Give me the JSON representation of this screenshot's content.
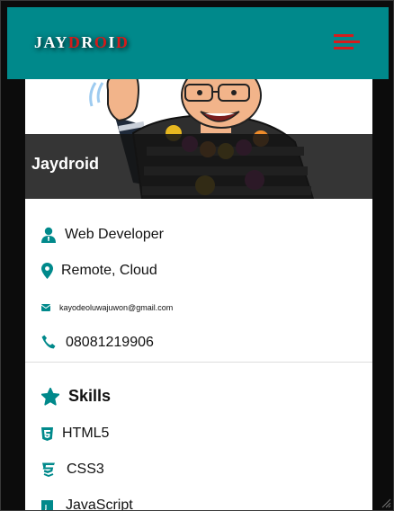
{
  "navbar": {
    "brand_parts": [
      "JAY",
      "D",
      "R",
      "O",
      "I",
      "D"
    ],
    "brand_colors": {
      "white": "#ffffff",
      "red": "#d41b1b"
    },
    "menu_icon": "hamburger-menu-icon",
    "background": "#00898b"
  },
  "profile": {
    "name": "Jaydroid",
    "photo_alt": "avatar-illustration"
  },
  "details": [
    {
      "icon": "user-tie-icon",
      "text": "Web Developer"
    },
    {
      "icon": "location-pin-icon",
      "text": "Remote, Cloud"
    },
    {
      "icon": "envelope-icon",
      "text": "kayodeoluwajuwon@gmail.com"
    },
    {
      "icon": "phone-icon",
      "text": "08081219906"
    }
  ],
  "skills": {
    "title": "Skills",
    "title_icon": "star-icon",
    "items": [
      {
        "icon": "html5-icon",
        "text": "HTML5"
      },
      {
        "icon": "css3-icon",
        "text": "CSS3"
      },
      {
        "icon": "js-icon",
        "text": "JavaScript"
      }
    ]
  },
  "colors": {
    "accent": "#00898b",
    "text": "#111111",
    "dark": "#0c0c0c"
  }
}
